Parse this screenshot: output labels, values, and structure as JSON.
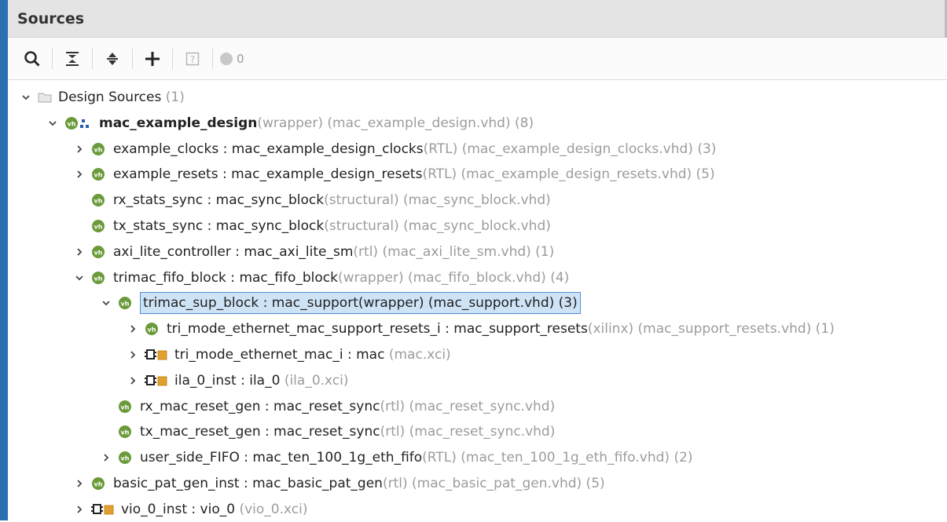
{
  "panel": {
    "title": "Sources"
  },
  "toolbar": {
    "buttons": [
      {
        "icon": "search-icon"
      },
      {
        "icon": "collapse-all-icon"
      },
      {
        "icon": "expand-all-icon"
      },
      {
        "icon": "add-sources-icon"
      },
      {
        "icon": "help-icon"
      }
    ],
    "status_count": "0"
  },
  "tree": [
    {
      "depth": 0,
      "chevron": "down",
      "icon": "folder",
      "name": "Design Sources",
      "suffix": " (1)"
    },
    {
      "depth": 1,
      "chevron": "down",
      "icon": "vhdl-hier",
      "name": "mac_example_design",
      "bold": true,
      "suffix": "(wrapper) (mac_example_design.vhd) (8)"
    },
    {
      "depth": 2,
      "chevron": "right",
      "icon": "vhdl",
      "name": "example_clocks : mac_example_design_clocks",
      "suffix": "(RTL) (mac_example_design_clocks.vhd) (3)"
    },
    {
      "depth": 2,
      "chevron": "right",
      "icon": "vhdl",
      "name": "example_resets : mac_example_design_resets",
      "suffix": "(RTL) (mac_example_design_resets.vhd) (5)"
    },
    {
      "depth": 2,
      "chevron": "none",
      "icon": "vhdl",
      "name": "rx_stats_sync : mac_sync_block",
      "suffix": "(structural) (mac_sync_block.vhd)"
    },
    {
      "depth": 2,
      "chevron": "none",
      "icon": "vhdl",
      "name": "tx_stats_sync : mac_sync_block",
      "suffix": "(structural) (mac_sync_block.vhd)"
    },
    {
      "depth": 2,
      "chevron": "right",
      "icon": "vhdl",
      "name": "axi_lite_controller : mac_axi_lite_sm",
      "suffix": "(rtl) (mac_axi_lite_sm.vhd) (1)"
    },
    {
      "depth": 2,
      "chevron": "down",
      "icon": "vhdl",
      "name": "trimac_fifo_block : mac_fifo_block",
      "suffix": "(wrapper) (mac_fifo_block.vhd) (4)"
    },
    {
      "depth": 3,
      "chevron": "down",
      "icon": "vhdl",
      "name": "trimac_sup_block : mac_support",
      "suffix": "(wrapper) (mac_support.vhd) (3)",
      "selected": true
    },
    {
      "depth": 4,
      "chevron": "right",
      "icon": "vhdl",
      "name": "tri_mode_ethernet_mac_support_resets_i : mac_support_resets",
      "suffix": "(xilinx) (mac_support_resets.vhd) (1)"
    },
    {
      "depth": 4,
      "chevron": "right",
      "icon": "ip",
      "name": "tri_mode_ethernet_mac_i : mac",
      "suffix": " (mac.xci)"
    },
    {
      "depth": 4,
      "chevron": "right",
      "icon": "ip",
      "name": "ila_0_inst : ila_0",
      "suffix": " (ila_0.xci)"
    },
    {
      "depth": 3,
      "chevron": "none",
      "icon": "vhdl",
      "name": "rx_mac_reset_gen : mac_reset_sync",
      "suffix": "(rtl) (mac_reset_sync.vhd)"
    },
    {
      "depth": 3,
      "chevron": "none",
      "icon": "vhdl",
      "name": "tx_mac_reset_gen : mac_reset_sync",
      "suffix": "(rtl) (mac_reset_sync.vhd)"
    },
    {
      "depth": 3,
      "chevron": "right",
      "icon": "vhdl",
      "name": "user_side_FIFO : mac_ten_100_1g_eth_fifo",
      "suffix": "(RTL) (mac_ten_100_1g_eth_fifo.vhd) (2)"
    },
    {
      "depth": 2,
      "chevron": "right",
      "icon": "vhdl",
      "name": "basic_pat_gen_inst : mac_basic_pat_gen",
      "suffix": "(rtl) (mac_basic_pat_gen.vhd) (5)"
    },
    {
      "depth": 2,
      "chevron": "right",
      "icon": "ip",
      "name": "vio_0_inst : vio_0",
      "suffix": " (vio_0.xci)"
    }
  ],
  "colors": {
    "accent_border": "#2d6fb3",
    "selection_bg": "#cfe3f7",
    "selection_border": "#4c8fd1",
    "vhdl_icon": "#6a9a3a",
    "ip_icon": "#e0a030",
    "muted_text": "#9c9c9c"
  }
}
